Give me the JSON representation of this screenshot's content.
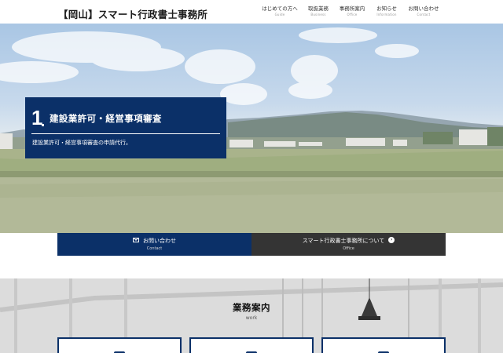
{
  "header": {
    "logo": "【岡山】スマート行政書士事務所",
    "nav": [
      {
        "jp": "はじめての方へ",
        "en": "Guide"
      },
      {
        "jp": "取扱業務",
        "en": "Business"
      },
      {
        "jp": "事務所案内",
        "en": "Office"
      },
      {
        "jp": "お知らせ",
        "en": "Information"
      },
      {
        "jp": "お問い合わせ",
        "en": "Contact"
      }
    ]
  },
  "hero": {
    "number": "1",
    "title": "建設業許可・経営事項審査",
    "subtitle": "建設業許可・経営事項審査の申請代行。"
  },
  "cta": {
    "contact": {
      "label": "お問い合わせ",
      "en": "Contact",
      "icon": "mail-icon"
    },
    "office": {
      "label": "スマート行政書士事務所について",
      "en": "Office",
      "icon": "arrow-circle-icon"
    }
  },
  "work": {
    "title": "業務案内",
    "subtitle": "work"
  },
  "colors": {
    "navy": "#0b3068",
    "dark": "#343434"
  }
}
